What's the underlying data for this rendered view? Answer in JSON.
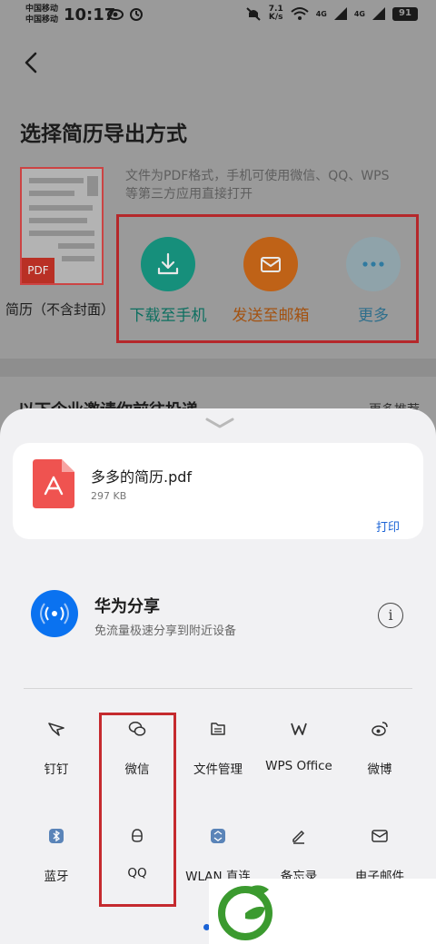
{
  "status_bar": {
    "carrier_1": "中国移动",
    "carrier_2": "中国移动",
    "time": "10:17",
    "speed_value": "7.1",
    "speed_unit": "K/s",
    "signal_1": "4G",
    "signal_2": "4G",
    "battery": "91"
  },
  "page": {
    "title": "选择简历导出方式",
    "thumb_badge": "PDF",
    "thumb_caption": "简历（不含封面）",
    "hint": "文件为PDF格式，手机可使用微信、QQ、WPS等第三方应用直接打开",
    "options": [
      {
        "label": "下载至手机",
        "icon": "download-icon",
        "color": "#1aa58f"
      },
      {
        "label": "发送至邮箱",
        "icon": "mail-icon",
        "color": "#d9731c"
      },
      {
        "label": "更多",
        "icon": "more-dots-icon",
        "color": "#6b9fb2"
      }
    ],
    "section_title": "以下企业邀请你前往投递",
    "section_more": "更多推荐"
  },
  "sheet": {
    "file": {
      "name": "多多的简历.pdf",
      "size": "297 KB",
      "print": "打印"
    },
    "huawei_share": {
      "title": "华为分享",
      "subtitle": "免流量极速分享到附近设备",
      "info_icon": "i"
    },
    "apps_row1": [
      {
        "label": "钉钉",
        "icon": "dingtalk-icon"
      },
      {
        "label": "微信",
        "icon": "wechat-icon"
      },
      {
        "label": "文件管理",
        "icon": "file-manager-icon"
      },
      {
        "label": "WPS Office",
        "icon": "wps-icon"
      },
      {
        "label": "微博",
        "icon": "weibo-icon"
      }
    ],
    "apps_row2": [
      {
        "label": "蓝牙",
        "icon": "bluetooth-icon"
      },
      {
        "label": "QQ",
        "icon": "qq-icon"
      },
      {
        "label": "WLAN 直连",
        "icon": "wlan-direct-icon"
      },
      {
        "label": "备忘录",
        "icon": "memo-icon"
      },
      {
        "label": "电子邮件",
        "icon": "email-icon"
      }
    ]
  },
  "colors": {
    "highlight": "#c52a2e",
    "link": "#1b63d6",
    "share_blue": "#0a72f0",
    "watermark_green": "#3b9a2f"
  }
}
